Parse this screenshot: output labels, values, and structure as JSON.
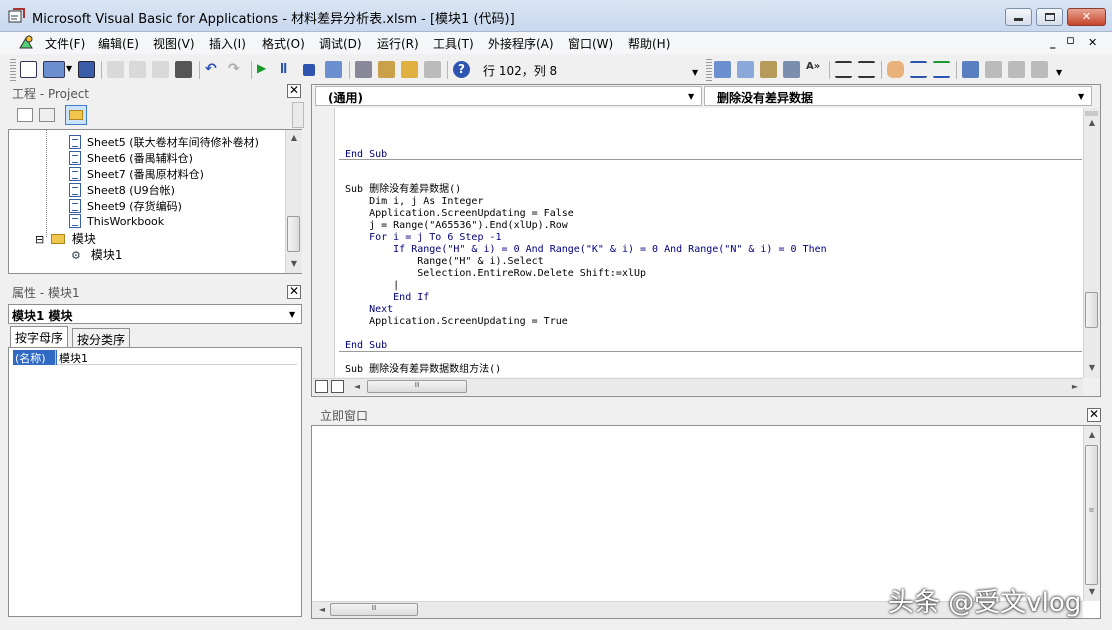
{
  "window": {
    "title": "Microsoft Visual Basic for Applications - 材料差异分析表.xlsm - [模块1 (代码)]",
    "minimize": "─",
    "maximize": "▭",
    "close": "✕"
  },
  "menu": {
    "items": [
      "文件(F)",
      "编辑(E)",
      "视图(V)",
      "插入(I)",
      "格式(O)",
      "调试(D)",
      "运行(R)",
      "工具(T)",
      "外接程序(A)",
      "窗口(W)",
      "帮助(H)"
    ],
    "mdi_minimize": "_",
    "mdi_restore": "▫",
    "mdi_close": "✕"
  },
  "toolbar": {
    "position": "行 102，列 8"
  },
  "project": {
    "title": "工程 - Project",
    "close": "✕",
    "items": [
      "Sheet5 (联大卷材车间待修补卷材)",
      "Sheet6 (番禺辅料仓)",
      "Sheet7 (番禺原材料仓)",
      "Sheet8 (U9台帐)",
      "Sheet9 (存货编码)",
      "ThisWorkbook"
    ],
    "folder": "模块",
    "folder_toggle": "⊟",
    "module": "模块1"
  },
  "properties": {
    "title": "属性 - 模块1",
    "close": "✕",
    "object_selected": "模块1 模块",
    "tabs": [
      "按字母序",
      "按分类序"
    ],
    "name_key": "(名称)",
    "name_value": "模块1"
  },
  "code": {
    "object_combo": "(通用)",
    "proc_combo": "删除没有差异数据",
    "lines": [
      "End Sub",
      "Sub 删除没有差异数据()",
      "    Dim i, j As Integer",
      "    Application.ScreenUpdating = False",
      "    j = Range(\"A65536\").End(xlUp).Row",
      "    For i = j To 6 Step -1",
      "        If Range(\"H\" & i) = 0 And Range(\"K\" & i) = 0 And Range(\"N\" & i) = 0 Then",
      "            Range(\"H\" & i).Select",
      "            Selection.EntireRow.Delete Shift:=xlUp",
      "        |",
      "        End If",
      "    Next",
      "    Application.ScreenUpdating = True",
      "End Sub",
      "Sub 删除没有差异数据数组方法()"
    ]
  },
  "immediate": {
    "title": "立即窗口",
    "close": "✕"
  },
  "scroll": {
    "up": "▲",
    "down": "▼",
    "left": "◄",
    "right": "►",
    "grip": "Ⅲ"
  },
  "watermark": "头条 @受文vlog",
  "colors": {
    "keyword": "#00007f",
    "selection": "#316ac5"
  }
}
